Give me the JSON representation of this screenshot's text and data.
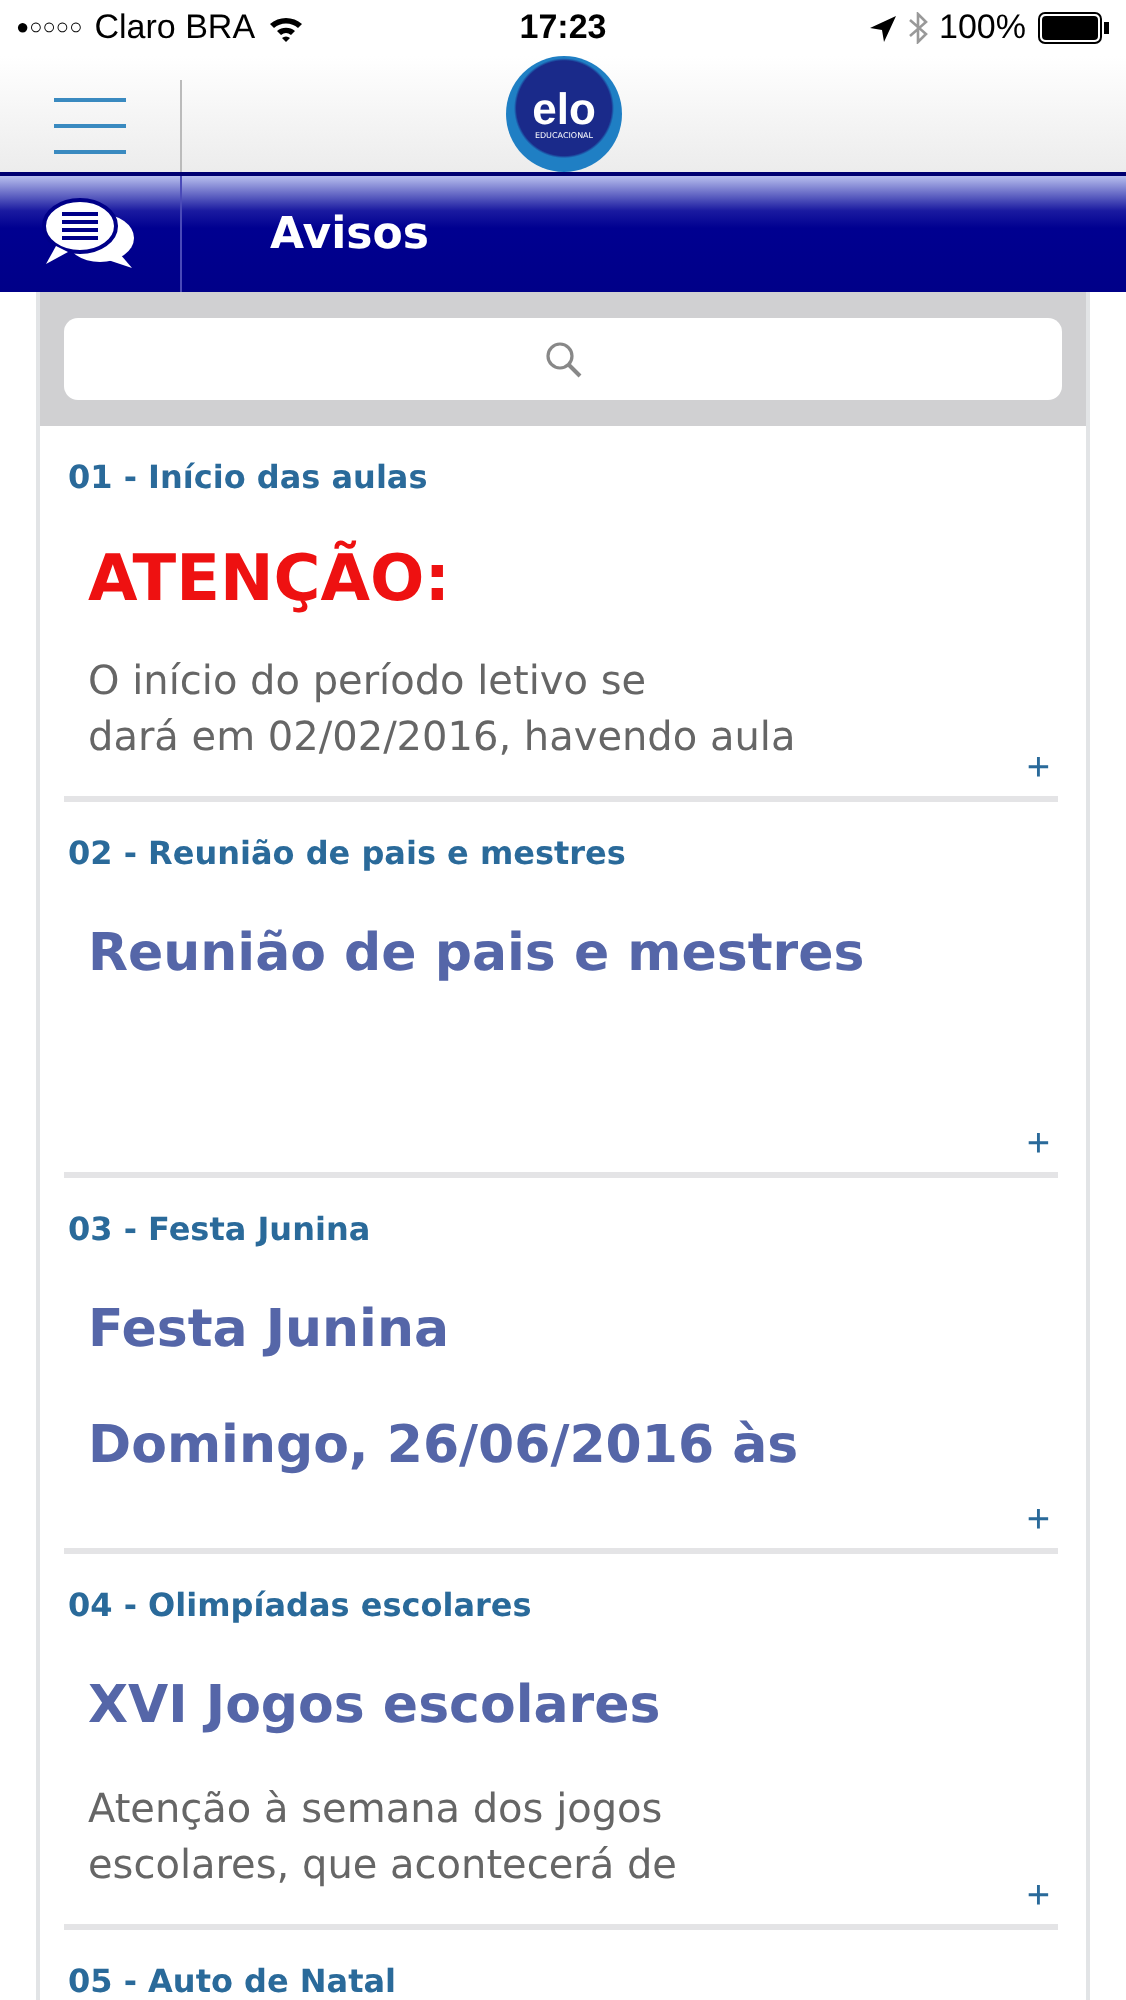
{
  "status_bar": {
    "signal_dots": "●○○○○",
    "carrier": "Claro BRA",
    "time": "17:23",
    "battery": "100%"
  },
  "header": {
    "logo": "elo",
    "logo_sub": "EDUCACIONAL"
  },
  "title_bar": {
    "title": "Avisos"
  },
  "notices": [
    {
      "title": "01 - Início das aulas",
      "blocks": [
        {
          "kind": "alert",
          "text": "ATENÇÃO:"
        },
        {
          "kind": "text",
          "text": "O início do período letivo se"
        },
        {
          "kind": "text",
          "text": "dará em 02/02/2016, havendo aula"
        }
      ],
      "expand": "+"
    },
    {
      "title": "02 - Reunião de pais e mestres",
      "blocks": [
        {
          "kind": "heading",
          "text": "Reunião de pais e mestres"
        }
      ],
      "expand": "+"
    },
    {
      "title": "03 - Festa Junina",
      "blocks": [
        {
          "kind": "heading",
          "text": "Festa Junina"
        },
        {
          "kind": "heading",
          "text": "Domingo, 26/06/2016 às"
        }
      ],
      "expand": "+"
    },
    {
      "title": "04 - Olimpíadas escolares",
      "blocks": [
        {
          "kind": "heading",
          "text": "XVI Jogos escolares"
        },
        {
          "kind": "text",
          "text": "Atenção à semana dos jogos"
        },
        {
          "kind": "text",
          "text": "escolares, que acontecerá de"
        }
      ],
      "expand": "+"
    },
    {
      "title": "05 - Auto de Natal"
    }
  ]
}
